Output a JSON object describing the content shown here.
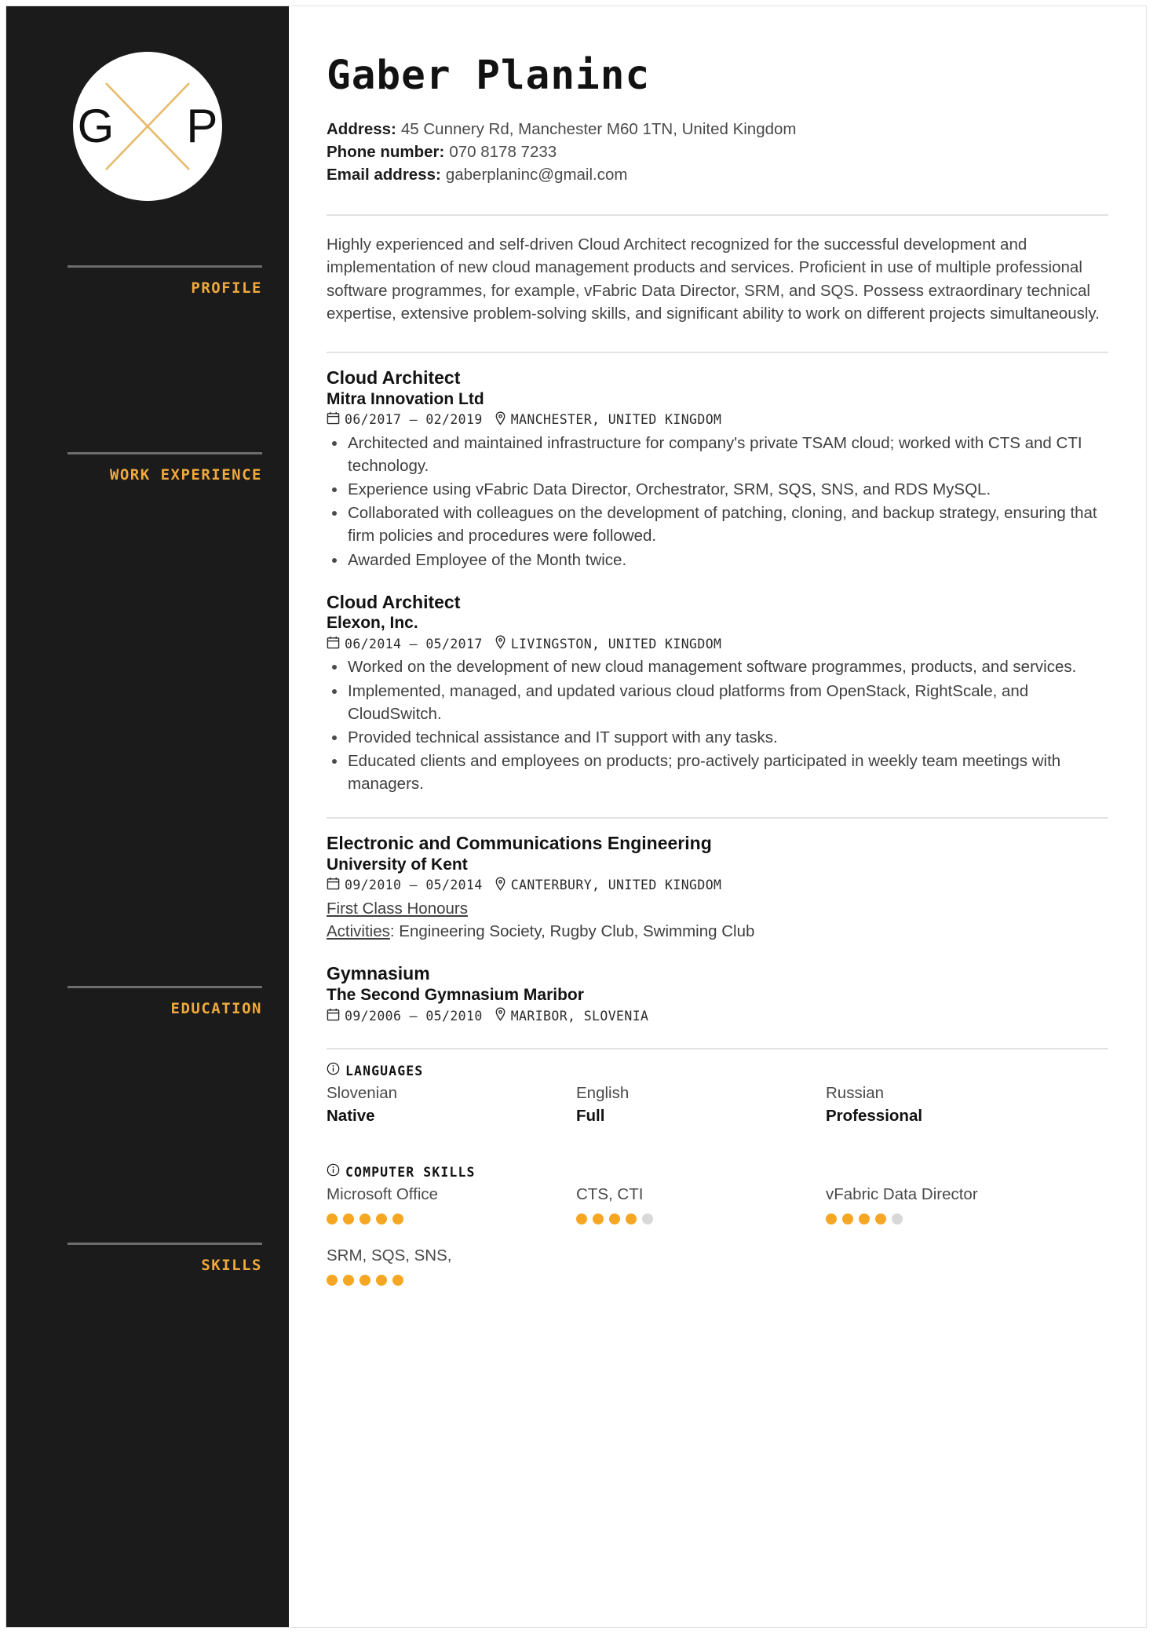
{
  "colors": {
    "sidebar_bg": "#1b1b1b",
    "accent": "#f0a93c",
    "dot_filled": "#f5a623",
    "dot_empty": "#d8d8d8"
  },
  "sidebar": {
    "monogram": {
      "left_initial": "G",
      "right_initial": "P"
    },
    "sections": [
      {
        "label": "PROFILE"
      },
      {
        "label": "WORK EXPERIENCE"
      },
      {
        "label": "EDUCATION"
      },
      {
        "label": "SKILLS"
      }
    ]
  },
  "header": {
    "name": "Gaber Planinc",
    "contacts": [
      {
        "label": "Address:",
        "value": "45 Cunnery Rd, Manchester M60 1TN, United Kingdom"
      },
      {
        "label": "Phone number:",
        "value": "070 8178 7233"
      },
      {
        "label": "Email address:",
        "value": "gaberplaninc@gmail.com"
      }
    ]
  },
  "profile": {
    "text": "Highly experienced and self-driven Cloud Architect recognized for the successful development and implementation of new cloud management products and services. Proficient in use of multiple professional software programmes, for example, vFabric Data Director, SRM, and SQS. Possess extraordinary technical expertise, extensive problem-solving skills, and significant ability to work on different projects simultaneously."
  },
  "work_experience": [
    {
      "title": "Cloud Architect",
      "organization": "Mitra Innovation Ltd",
      "dates": "06/2017 – 02/2019",
      "location": "MANCHESTER, UNITED KINGDOM",
      "bullets": [
        "Architected and maintained infrastructure for company's private TSAM cloud; worked with CTS and CTI technology.",
        "Experience using vFabric Data Director, Orchestrator, SRM, SQS, SNS, and RDS MySQL.",
        "Collaborated with colleagues on the development of patching, cloning, and backup strategy, ensuring that firm policies and procedures were followed.",
        "Awarded Employee of the Month twice."
      ]
    },
    {
      "title": "Cloud Architect",
      "organization": "Elexon, Inc.",
      "dates": "06/2014 – 05/2017",
      "location": "LIVINGSTON, UNITED KINGDOM",
      "bullets": [
        "Worked on the development of new cloud management software programmes, products, and services.",
        "Implemented, managed, and updated various cloud platforms from OpenStack, RightScale, and CloudSwitch.",
        "Provided technical assistance and IT support with any tasks.",
        "Educated clients and employees on products; pro-actively participated in weekly team meetings with managers."
      ]
    }
  ],
  "education": [
    {
      "title": "Electronic and Communications Engineering",
      "organization": "University of Kent",
      "dates": "09/2010 – 05/2014",
      "location": "CANTERBURY, UNITED KINGDOM",
      "grade": "First Class Honours",
      "activities_label": "Activities",
      "activities_value": ": Engineering Society, Rugby Club, Swimming Club"
    },
    {
      "title": "Gymnasium",
      "organization": "The Second Gymnasium Maribor",
      "dates": "09/2006 – 05/2010",
      "location": "MARIBOR, SLOVENIA",
      "grade": "",
      "activities_label": "",
      "activities_value": ""
    }
  ],
  "languages": {
    "heading": "LANGUAGES",
    "items": [
      {
        "name": "Slovenian",
        "level": "Native"
      },
      {
        "name": "English",
        "level": "Full"
      },
      {
        "name": "Russian",
        "level": "Professional"
      }
    ]
  },
  "computer_skills": {
    "heading": "COMPUTER SKILLS",
    "max_dots": 5,
    "items": [
      {
        "name": "Microsoft Office",
        "rating": 5
      },
      {
        "name": "CTS, CTI",
        "rating": 4
      },
      {
        "name": "vFabric Data Director",
        "rating": 4
      },
      {
        "name": "SRM, SQS, SNS,",
        "rating": 5
      }
    ]
  }
}
